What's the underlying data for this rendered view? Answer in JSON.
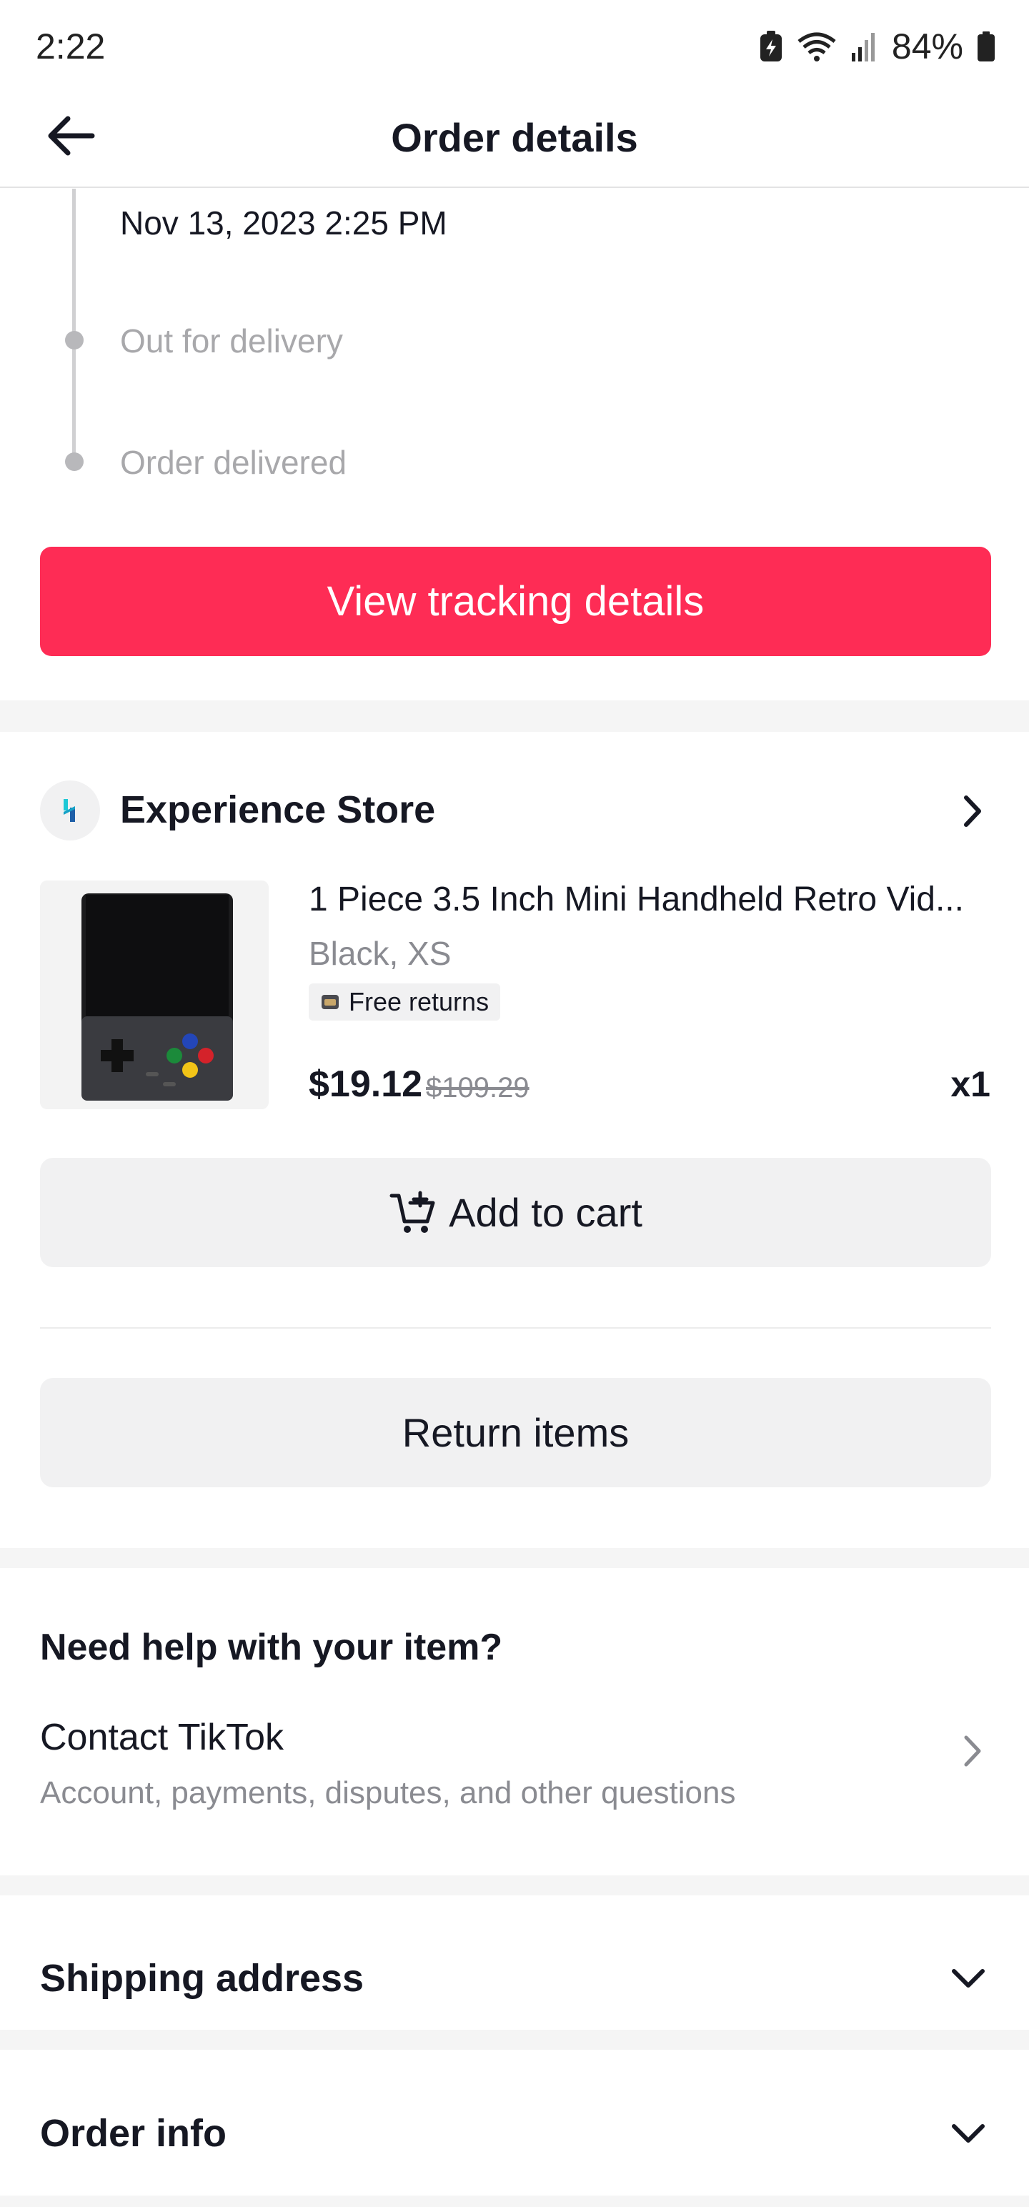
{
  "status_bar": {
    "time": "2:22",
    "battery": "84%"
  },
  "header": {
    "title": "Order details",
    "back_icon": "arrow-left-icon"
  },
  "timeline": {
    "date": "Nov 13, 2023 2:25 PM",
    "steps": [
      {
        "label": "Out for delivery"
      },
      {
        "label": "Order delivered"
      }
    ]
  },
  "tracking_button": {
    "label": "View tracking details",
    "color": "#fe2c55"
  },
  "store": {
    "name": "Experience Store",
    "chevron_icon": "chevron-right-icon"
  },
  "product": {
    "title": "1 Piece 3.5 Inch Mini Handheld Retro Vid...",
    "variant": "Black, XS",
    "badge": "Free returns",
    "price": "$19.12",
    "original_price": "$109.29",
    "quantity": "x1"
  },
  "actions": {
    "add_to_cart": "Add to cart",
    "return_items": "Return items"
  },
  "help": {
    "title": "Need help with your item?",
    "contact_label": "Contact TikTok",
    "contact_sub": "Account, payments, disputes, and other questions"
  },
  "sections": {
    "shipping_address": "Shipping address",
    "order_info": "Order info"
  }
}
